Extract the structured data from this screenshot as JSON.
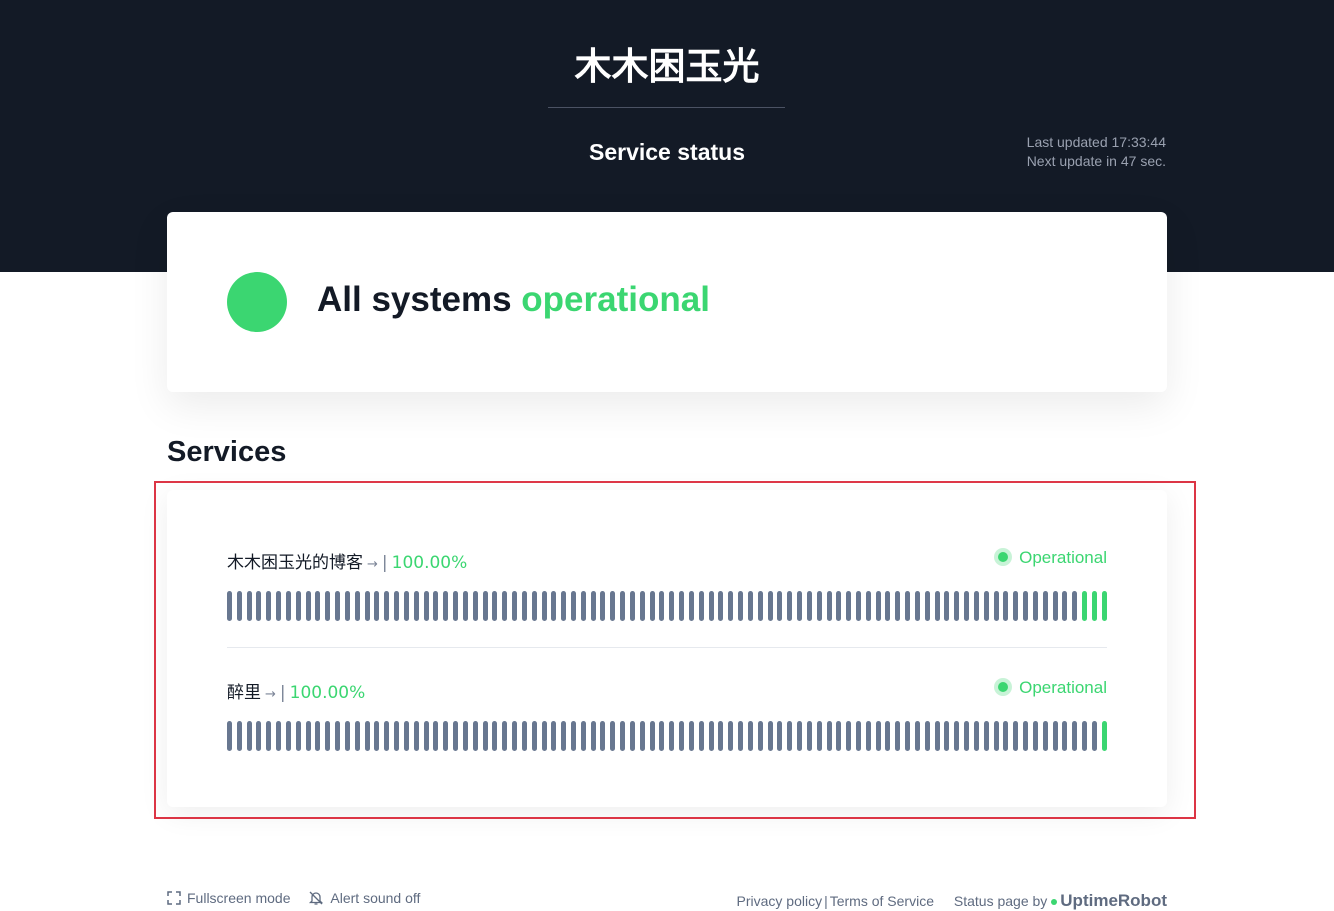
{
  "header": {
    "site_title": "木木困玉光",
    "page_subtitle": "Service status",
    "last_updated": "Last updated 17:33:44",
    "next_update": "Next update in 47 sec."
  },
  "summary": {
    "prefix": "All systems",
    "state": "operational"
  },
  "services": {
    "heading": "Services",
    "items": [
      {
        "name": "木木困玉光的博客",
        "arrow": "→",
        "separator": "|",
        "uptime": "100.00%",
        "status": "Operational",
        "bar_count": 90,
        "green_bars_at_end": 3
      },
      {
        "name": "醉里",
        "arrow": "→",
        "separator": "|",
        "uptime": "100.00%",
        "status": "Operational",
        "bar_count": 90,
        "green_bars_at_end": 1
      }
    ]
  },
  "footer": {
    "fullscreen_label": "Fullscreen mode",
    "alert_sound_label": "Alert sound off",
    "privacy_label": "Privacy policy",
    "separator": "|",
    "terms_label": "Terms of Service",
    "powered_by": "Status page by",
    "brand": "UptimeRobot"
  },
  "colors": {
    "header_bg": "#131a26",
    "operational": "#3bd671",
    "bar_gray": "#687790",
    "highlight_outline": "#dc3545"
  },
  "icons": [
    "fullscreen-icon",
    "bell-off-icon",
    "arrow-right-icon",
    "status-dot-icon"
  ]
}
